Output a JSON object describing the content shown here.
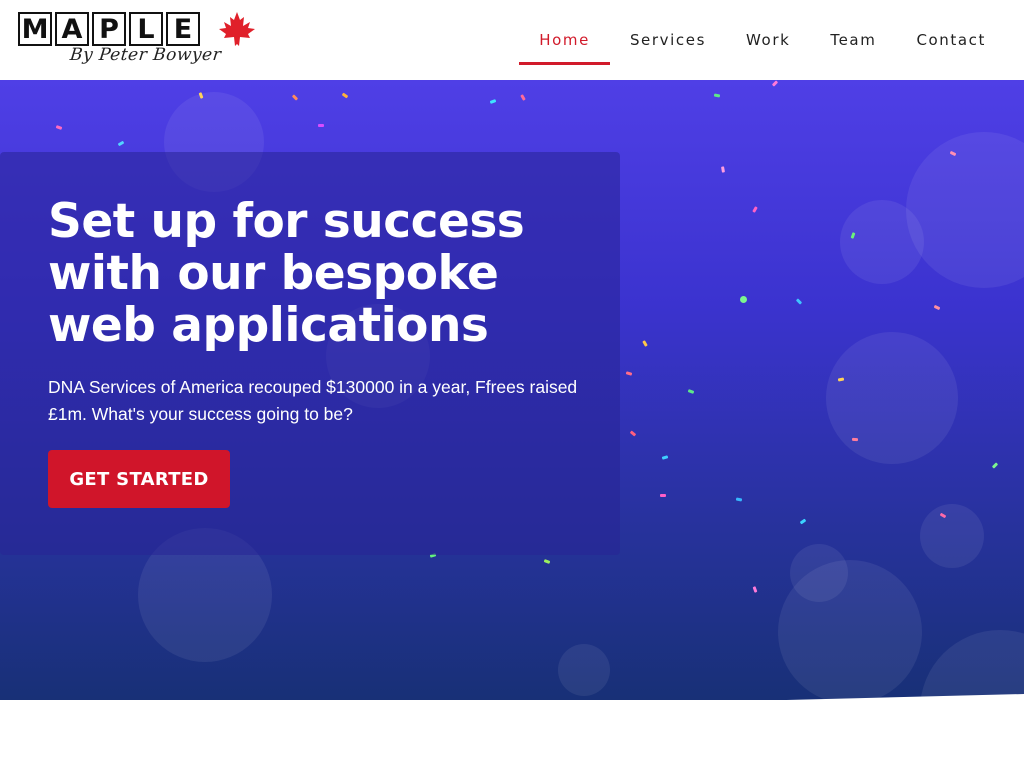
{
  "brand": {
    "letters": [
      "M",
      "A",
      "P",
      "L",
      "E"
    ],
    "tagline": "By Peter Bowyer",
    "leaf_icon": "maple-leaf-icon",
    "leaf_color": "#e0202a"
  },
  "nav": {
    "items": [
      {
        "label": "Home",
        "active": true
      },
      {
        "label": "Services",
        "active": false
      },
      {
        "label": "Work",
        "active": false
      },
      {
        "label": "Team",
        "active": false
      },
      {
        "label": "Contact",
        "active": false
      }
    ],
    "active_color": "#d11a2a"
  },
  "hero": {
    "headline": "Set up for success with our bespoke web applications",
    "subtext": "DNA Services of America recouped $130000 in a year, Ffrees raised £1m. What's your success going to be?",
    "cta_label": "GET STARTED",
    "cta_color": "#d0152a",
    "background_top": "#4f3fe6",
    "background_bottom": "#163072"
  }
}
